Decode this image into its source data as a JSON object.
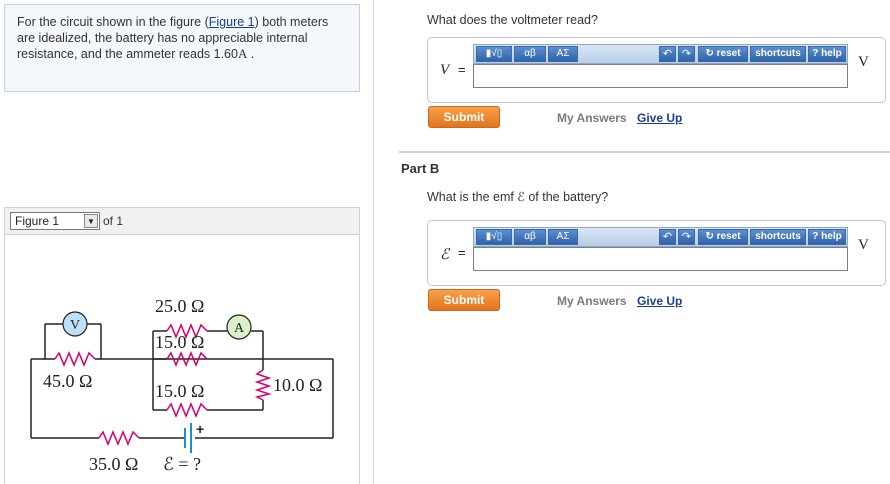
{
  "problem": {
    "text_before_link": "For the circuit shown in the figure (",
    "link": "Figure 1",
    "text_after_link": ") both meters are idealized, the battery has no appreciable internal resistance, and the ammeter reads 1.60",
    "unit": "A",
    "tail": " ."
  },
  "figure_nav": {
    "selected": "Figure 1",
    "of_text": "of 1"
  },
  "circuit": {
    "voltmeter": "V",
    "ammeter": "A",
    "r1": "25.0 Ω",
    "r2": "15.0 Ω",
    "r3": "45.0 Ω",
    "r4": "15.0 Ω",
    "r5": "10.0 Ω",
    "r6": "35.0 Ω",
    "emf": "ℰ = ?",
    "plus": "+"
  },
  "part_a": {
    "question": "What does the voltmeter read?",
    "var": "V",
    "equals": "=",
    "unit": "V",
    "submit": "Submit",
    "my_answers": "My Answers",
    "give_up": "Give Up"
  },
  "part_b": {
    "title": "Part B",
    "question": "What is the emf ℰ of the battery?",
    "var": "ℰ",
    "equals": "=",
    "unit": "V",
    "submit": "Submit",
    "my_answers": "My Answers",
    "give_up": "Give Up"
  },
  "toolbar": {
    "templates": "▮√▯",
    "greek": "αβ",
    "symbols": "ΑΣ",
    "undo_icon": "undo-icon",
    "redo_icon": "redo-icon",
    "reset": "reset",
    "shortcuts": "shortcuts",
    "help": "help"
  },
  "colors": {
    "submit": "#e98a2e",
    "link": "#1b3f8b",
    "toolbar": "#2f63a8"
  }
}
